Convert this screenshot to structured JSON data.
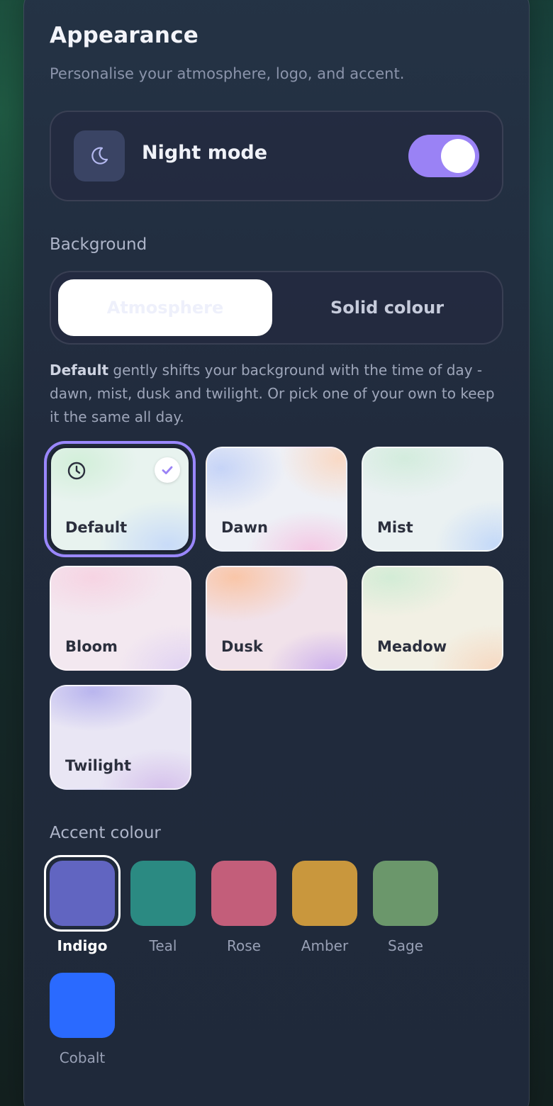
{
  "header": {
    "title": "Appearance",
    "subtitle": "Personalise your atmosphere, logo, and accent."
  },
  "night_mode": {
    "label": "Night mode",
    "icon": "moon-icon",
    "enabled": true,
    "toggle_color": "#9a82f5"
  },
  "background": {
    "section_label": "Background",
    "tabs": [
      {
        "label": "Atmosphere",
        "active": true
      },
      {
        "label": "Solid colour",
        "active": false
      }
    ],
    "description_bold": "Default",
    "description_rest": " gently shifts your background with the time of day - dawn, mist, dusk and twilight. Or pick one of your own to keep it the same all day.",
    "tiles": [
      {
        "label": "Default",
        "selected": true,
        "icon": "clock-icon"
      },
      {
        "label": "Dawn",
        "selected": false
      },
      {
        "label": "Mist",
        "selected": false
      },
      {
        "label": "Bloom",
        "selected": false
      },
      {
        "label": "Dusk",
        "selected": false
      },
      {
        "label": "Meadow",
        "selected": false
      },
      {
        "label": "Twilight",
        "selected": false
      }
    ],
    "selection_color": "#9a87ff"
  },
  "accent": {
    "section_label": "Accent colour",
    "swatches": [
      {
        "label": "Indigo",
        "color": "#6165c1",
        "selected": true
      },
      {
        "label": "Teal",
        "color": "#2b8a82",
        "selected": false
      },
      {
        "label": "Rose",
        "color": "#c35e7a",
        "selected": false
      },
      {
        "label": "Amber",
        "color": "#c9973d",
        "selected": false
      },
      {
        "label": "Sage",
        "color": "#6b976b",
        "selected": false
      },
      {
        "label": "Cobalt",
        "color": "#2a6aff",
        "selected": false
      }
    ]
  }
}
